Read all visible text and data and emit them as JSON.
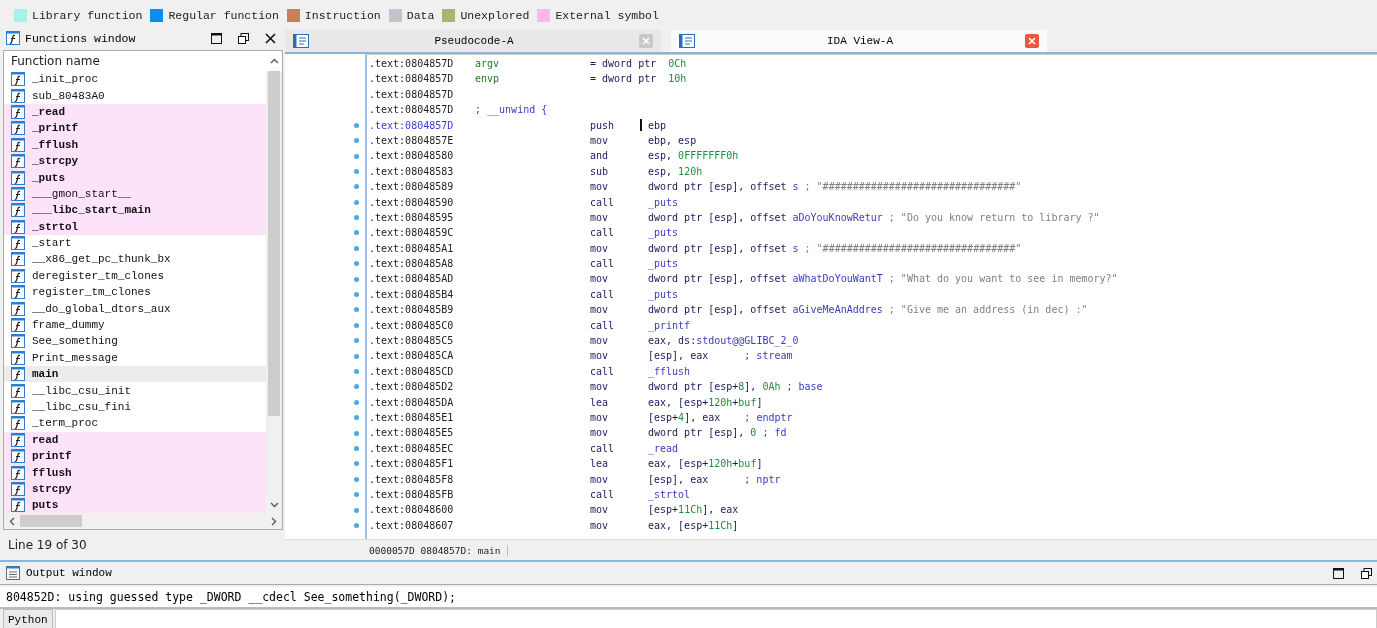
{
  "legend": [
    {
      "label": "Library function",
      "color": "#a6f0ee"
    },
    {
      "label": "Regular function",
      "color": "#0a8ff0"
    },
    {
      "label": "Instruction",
      "color": "#c8805a"
    },
    {
      "label": "Data",
      "color": "#c4c4cc"
    },
    {
      "label": "Unexplored",
      "color": "#b0b070"
    },
    {
      "label": "External symbol",
      "color": "#ffb4f4"
    }
  ],
  "functions_window": {
    "title": "Functions window",
    "column": "Function name",
    "status": "Line 19 of 30",
    "items": [
      {
        "name": "_init_proc",
        "external": false,
        "bold": false,
        "selected": false
      },
      {
        "name": "sub_80483A0",
        "external": false,
        "bold": false,
        "selected": false
      },
      {
        "name": "_read",
        "external": true,
        "bold": true,
        "selected": false
      },
      {
        "name": "_printf",
        "external": true,
        "bold": true,
        "selected": false
      },
      {
        "name": "_fflush",
        "external": true,
        "bold": true,
        "selected": false
      },
      {
        "name": "_strcpy",
        "external": true,
        "bold": true,
        "selected": false
      },
      {
        "name": "_puts",
        "external": true,
        "bold": true,
        "selected": false
      },
      {
        "name": "___gmon_start__",
        "external": true,
        "bold": false,
        "selected": false
      },
      {
        "name": "___libc_start_main",
        "external": true,
        "bold": true,
        "selected": false
      },
      {
        "name": "_strtol",
        "external": true,
        "bold": true,
        "selected": false
      },
      {
        "name": "_start",
        "external": false,
        "bold": false,
        "selected": false
      },
      {
        "name": "__x86_get_pc_thunk_bx",
        "external": false,
        "bold": false,
        "selected": false
      },
      {
        "name": "deregister_tm_clones",
        "external": false,
        "bold": false,
        "selected": false
      },
      {
        "name": "register_tm_clones",
        "external": false,
        "bold": false,
        "selected": false
      },
      {
        "name": "__do_global_dtors_aux",
        "external": false,
        "bold": false,
        "selected": false
      },
      {
        "name": "frame_dummy",
        "external": false,
        "bold": false,
        "selected": false
      },
      {
        "name": "See_something",
        "external": false,
        "bold": false,
        "selected": false
      },
      {
        "name": "Print_message",
        "external": false,
        "bold": false,
        "selected": false
      },
      {
        "name": "main",
        "external": false,
        "bold": true,
        "selected": true
      },
      {
        "name": "__libc_csu_init",
        "external": false,
        "bold": false,
        "selected": false
      },
      {
        "name": "__libc_csu_fini",
        "external": false,
        "bold": false,
        "selected": false
      },
      {
        "name": "_term_proc",
        "external": false,
        "bold": false,
        "selected": false
      },
      {
        "name": "read",
        "external": true,
        "bold": true,
        "selected": false
      },
      {
        "name": "printf",
        "external": true,
        "bold": true,
        "selected": false
      },
      {
        "name": "fflush",
        "external": true,
        "bold": true,
        "selected": false
      },
      {
        "name": "strcpy",
        "external": true,
        "bold": true,
        "selected": false
      },
      {
        "name": "puts",
        "external": true,
        "bold": true,
        "selected": false
      }
    ]
  },
  "tabs": [
    {
      "label": "Pseudocode-A",
      "selected": false
    },
    {
      "label": "IDA View-A",
      "selected": true
    }
  ],
  "disassembly": {
    "status": "0000057D 0804857D: main",
    "lines": [
      {
        "kind": "var",
        "addr": ".text:0804857D",
        "label": "argv",
        "dot": false,
        "current": false,
        "ops": [
          {
            "t": "= dword ptr  ",
            "kind": "txt"
          },
          {
            "t": "0Ch",
            "kind": "num"
          }
        ]
      },
      {
        "kind": "var",
        "addr": ".text:0804857D",
        "label": "envp",
        "dot": false,
        "current": false,
        "ops": [
          {
            "t": "= dword ptr  ",
            "kind": "txt"
          },
          {
            "t": "10h",
            "kind": "num"
          }
        ]
      },
      {
        "kind": "blank",
        "addr": ".text:0804857D",
        "dot": false,
        "current": false
      },
      {
        "kind": "note",
        "addr": ".text:0804857D",
        "dot": false,
        "current": false,
        "ops": [
          {
            "t": "; __unwind {",
            "kind": "name"
          }
        ]
      },
      {
        "kind": "insn",
        "addr": ".text:0804857D",
        "mnem": "push",
        "dot": true,
        "current": true,
        "ops": [
          {
            "t": "ebp",
            "kind": "txt"
          }
        ]
      },
      {
        "kind": "insn",
        "addr": ".text:0804857E",
        "mnem": "mov",
        "dot": true,
        "current": false,
        "ops": [
          {
            "t": "ebp, esp",
            "kind": "txt"
          }
        ]
      },
      {
        "kind": "insn",
        "addr": ".text:08048580",
        "mnem": "and",
        "dot": true,
        "current": false,
        "ops": [
          {
            "t": "esp, ",
            "kind": "txt"
          },
          {
            "t": "0FFFFFFF0h",
            "kind": "num"
          }
        ]
      },
      {
        "kind": "insn",
        "addr": ".text:08048583",
        "mnem": "sub",
        "dot": true,
        "current": false,
        "ops": [
          {
            "t": "esp, ",
            "kind": "txt"
          },
          {
            "t": "120h",
            "kind": "num"
          }
        ]
      },
      {
        "kind": "insn",
        "addr": ".text:08048589",
        "mnem": "mov",
        "dot": true,
        "current": false,
        "ops": [
          {
            "t": "dword ptr [esp], offset ",
            "kind": "txt"
          },
          {
            "t": "s",
            "kind": "name"
          },
          {
            "t": " ; \"################################\"",
            "kind": "str"
          }
        ]
      },
      {
        "kind": "insn",
        "addr": ".text:08048590",
        "mnem": "call",
        "dot": true,
        "current": false,
        "ops": [
          {
            "t": "_puts",
            "kind": "name"
          }
        ]
      },
      {
        "kind": "insn",
        "addr": ".text:08048595",
        "mnem": "mov",
        "dot": true,
        "current": false,
        "ops": [
          {
            "t": "dword ptr [esp], offset ",
            "kind": "txt"
          },
          {
            "t": "aDoYouKnowRetur",
            "kind": "name"
          },
          {
            "t": " ; \"Do you know return to library ?\"",
            "kind": "str"
          }
        ]
      },
      {
        "kind": "insn",
        "addr": ".text:0804859C",
        "mnem": "call",
        "dot": true,
        "current": false,
        "ops": [
          {
            "t": "_puts",
            "kind": "name"
          }
        ]
      },
      {
        "kind": "insn",
        "addr": ".text:080485A1",
        "mnem": "mov",
        "dot": true,
        "current": false,
        "ops": [
          {
            "t": "dword ptr [esp], offset ",
            "kind": "txt"
          },
          {
            "t": "s",
            "kind": "name"
          },
          {
            "t": " ; \"################################\"",
            "kind": "str"
          }
        ]
      },
      {
        "kind": "insn",
        "addr": ".text:080485A8",
        "mnem": "call",
        "dot": true,
        "current": false,
        "ops": [
          {
            "t": "_puts",
            "kind": "name"
          }
        ]
      },
      {
        "kind": "insn",
        "addr": ".text:080485AD",
        "mnem": "mov",
        "dot": true,
        "current": false,
        "ops": [
          {
            "t": "dword ptr [esp], offset ",
            "kind": "txt"
          },
          {
            "t": "aWhatDoYouWantT",
            "kind": "name"
          },
          {
            "t": " ; \"What do you want to see in memory?\"",
            "kind": "str"
          }
        ]
      },
      {
        "kind": "insn",
        "addr": ".text:080485B4",
        "mnem": "call",
        "dot": true,
        "current": false,
        "ops": [
          {
            "t": "_puts",
            "kind": "name"
          }
        ]
      },
      {
        "kind": "insn",
        "addr": ".text:080485B9",
        "mnem": "mov",
        "dot": true,
        "current": false,
        "ops": [
          {
            "t": "dword ptr [esp], offset ",
            "kind": "txt"
          },
          {
            "t": "aGiveMeAnAddres",
            "kind": "name"
          },
          {
            "t": " ; \"Give me an address (in dec) :\"",
            "kind": "str"
          }
        ]
      },
      {
        "kind": "insn",
        "addr": ".text:080485C0",
        "mnem": "call",
        "dot": true,
        "current": false,
        "ops": [
          {
            "t": "_printf",
            "kind": "name"
          }
        ]
      },
      {
        "kind": "insn",
        "addr": ".text:080485C5",
        "mnem": "mov",
        "dot": true,
        "current": false,
        "ops": [
          {
            "t": "eax, ds:",
            "kind": "txt"
          },
          {
            "t": "stdout@@GLIBC_2_0",
            "kind": "name"
          }
        ]
      },
      {
        "kind": "insn",
        "addr": ".text:080485CA",
        "mnem": "mov",
        "dot": true,
        "current": false,
        "ops": [
          {
            "t": "[esp], eax      ",
            "kind": "txt"
          },
          {
            "t": "; stream",
            "kind": "name"
          }
        ]
      },
      {
        "kind": "insn",
        "addr": ".text:080485CD",
        "mnem": "call",
        "dot": true,
        "current": false,
        "ops": [
          {
            "t": "_fflush",
            "kind": "name"
          }
        ]
      },
      {
        "kind": "insn",
        "addr": ".text:080485D2",
        "mnem": "mov",
        "dot": true,
        "current": false,
        "ops": [
          {
            "t": "dword ptr [esp+",
            "kind": "txt"
          },
          {
            "t": "8",
            "kind": "num"
          },
          {
            "t": "], ",
            "kind": "txt"
          },
          {
            "t": "0Ah",
            "kind": "num"
          },
          {
            "t": " ; base",
            "kind": "name"
          }
        ]
      },
      {
        "kind": "insn",
        "addr": ".text:080485DA",
        "mnem": "lea",
        "dot": true,
        "current": false,
        "ops": [
          {
            "t": "eax, [esp+",
            "kind": "txt"
          },
          {
            "t": "120h",
            "kind": "num"
          },
          {
            "t": "+",
            "kind": "txt"
          },
          {
            "t": "buf",
            "kind": "num"
          },
          {
            "t": "]",
            "kind": "txt"
          }
        ]
      },
      {
        "kind": "insn",
        "addr": ".text:080485E1",
        "mnem": "mov",
        "dot": true,
        "current": false,
        "ops": [
          {
            "t": "[esp+",
            "kind": "txt"
          },
          {
            "t": "4",
            "kind": "num"
          },
          {
            "t": "], eax    ",
            "kind": "txt"
          },
          {
            "t": "; endptr",
            "kind": "name"
          }
        ]
      },
      {
        "kind": "insn",
        "addr": ".text:080485E5",
        "mnem": "mov",
        "dot": true,
        "current": false,
        "ops": [
          {
            "t": "dword ptr [esp], ",
            "kind": "txt"
          },
          {
            "t": "0",
            "kind": "num"
          },
          {
            "t": " ; fd",
            "kind": "name"
          }
        ]
      },
      {
        "kind": "insn",
        "addr": ".text:080485EC",
        "mnem": "call",
        "dot": true,
        "current": false,
        "ops": [
          {
            "t": "_read",
            "kind": "name"
          }
        ]
      },
      {
        "kind": "insn",
        "addr": ".text:080485F1",
        "mnem": "lea",
        "dot": true,
        "current": false,
        "ops": [
          {
            "t": "eax, [esp+",
            "kind": "txt"
          },
          {
            "t": "120h",
            "kind": "num"
          },
          {
            "t": "+",
            "kind": "txt"
          },
          {
            "t": "buf",
            "kind": "num"
          },
          {
            "t": "]",
            "kind": "txt"
          }
        ]
      },
      {
        "kind": "insn",
        "addr": ".text:080485F8",
        "mnem": "mov",
        "dot": true,
        "current": false,
        "ops": [
          {
            "t": "[esp], eax      ",
            "kind": "txt"
          },
          {
            "t": "; nptr",
            "kind": "name"
          }
        ]
      },
      {
        "kind": "insn",
        "addr": ".text:080485FB",
        "mnem": "call",
        "dot": true,
        "current": false,
        "ops": [
          {
            "t": "_strtol",
            "kind": "name"
          }
        ]
      },
      {
        "kind": "insn",
        "addr": ".text:08048600",
        "mnem": "mov",
        "dot": true,
        "current": false,
        "ops": [
          {
            "t": "[esp+",
            "kind": "txt"
          },
          {
            "t": "11Ch",
            "kind": "num"
          },
          {
            "t": "], eax",
            "kind": "txt"
          }
        ]
      },
      {
        "kind": "insn",
        "addr": ".text:08048607",
        "mnem": "mov",
        "dot": true,
        "current": false,
        "ops": [
          {
            "t": "eax, [esp+",
            "kind": "txt"
          },
          {
            "t": "11Ch",
            "kind": "num"
          },
          {
            "t": "]",
            "kind": "txt"
          }
        ]
      }
    ]
  },
  "output_window": {
    "title": "Output window",
    "message": "804852D: using guessed type _DWORD __cdecl See_something(_DWORD);",
    "button": "Python"
  }
}
